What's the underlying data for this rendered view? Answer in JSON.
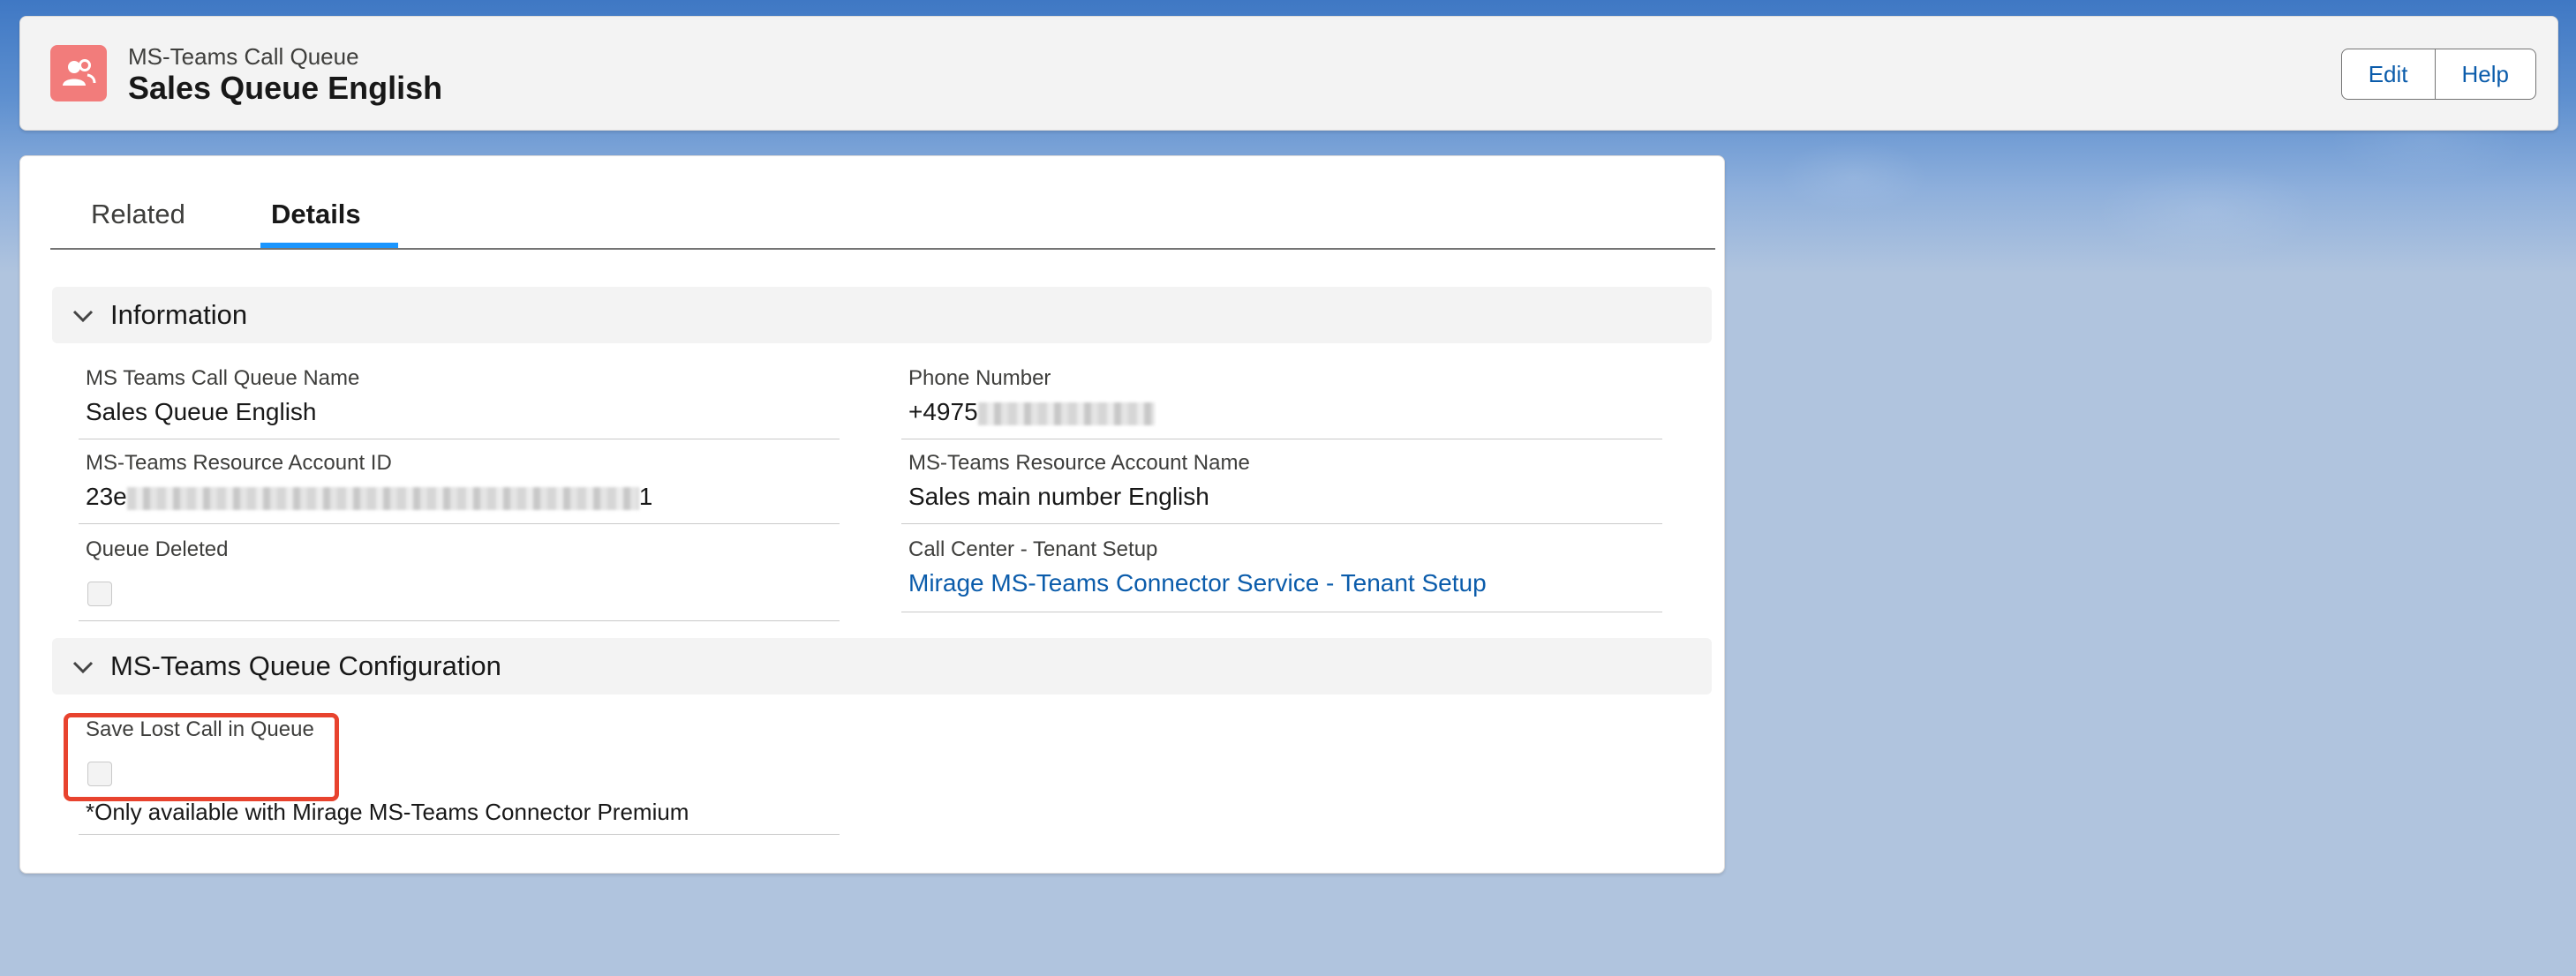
{
  "header": {
    "object_type": "MS-Teams Call Queue",
    "record_name": "Sales Queue English",
    "icon": "queue-users-icon",
    "icon_color": "#f27c7b",
    "buttons": {
      "edit": "Edit",
      "help": "Help"
    }
  },
  "tabs": {
    "related": "Related",
    "details": "Details",
    "active": "Details"
  },
  "sections": {
    "information": {
      "title": "Information",
      "fields": {
        "queue_name_label": "MS Teams Call Queue Name",
        "queue_name_value": "Sales Queue English",
        "phone_label": "Phone Number",
        "phone_value_visible": "+4975",
        "resource_id_label": "MS-Teams Resource Account ID",
        "resource_id_prefix": "23e",
        "resource_id_suffix": "1",
        "resource_name_label": "MS-Teams Resource Account Name",
        "resource_name_value": "Sales main number English",
        "queue_deleted_label": "Queue Deleted",
        "call_center_label": "Call Center - Tenant Setup",
        "call_center_value": "Mirage MS-Teams Connector Service - Tenant Setup"
      }
    },
    "configuration": {
      "title": "MS-Teams Queue Configuration",
      "fields": {
        "save_lost_call_label": "Save Lost Call in Queue",
        "save_lost_call_note": "*Only available with Mirage MS-Teams Connector Premium"
      }
    }
  },
  "colors": {
    "link": "#0b5cab",
    "tab_active": "#1b96ff",
    "highlight": "#e8432e"
  }
}
